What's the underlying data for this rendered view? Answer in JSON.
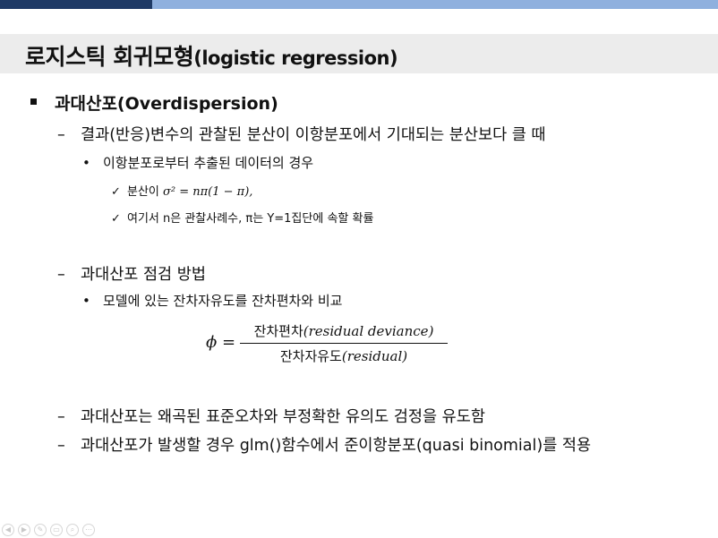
{
  "slide": {
    "title_main": "로지스틱 회귀모형",
    "title_sub": "(logistic regression)"
  },
  "content": {
    "section_bullet": "과대산포(Overdispersion)",
    "item1": "결과(반응)변수의 관찰된 분산이 이항분포에서 기대되는 분산보다 클 때",
    "item1_sub": "이항분포로부터 추출된 데이터의 경우",
    "check1_prefix": "분산이 ",
    "check1_formula": "σ² = nπ(1 − π),",
    "check2": "여기서 n은 관찰사례수, π는 Y=1집단에 속할 확률",
    "item2": "과대산포 점검 방법",
    "item2_sub": "모델에 있는 잔차자유도를 잔차편차와 비교",
    "formula": {
      "lhs": "ϕ",
      "eq": "=",
      "numerator_kr": "잔차편차",
      "numerator_en": "(residual deviance)",
      "denominator_kr": "잔차자유도",
      "denominator_en": "(residual)"
    },
    "item3": "과대산포는 왜곡된 표준오차와 부정확한 유의도 검정을 유도함",
    "item4": "과대산포가 발생할 경우 glm()함수에서 준이항분포(quasi binomial)를 적용"
  },
  "symbols": {
    "dash": "–",
    "dot": "•",
    "check": "✓"
  },
  "controls": [
    "◀",
    "▶",
    "✎",
    "▭",
    "⌕",
    "⋯"
  ],
  "colors": {
    "top_bar_dark": "#1f3a66",
    "top_bar_light": "#8fb0de",
    "title_band": "#ececec"
  }
}
